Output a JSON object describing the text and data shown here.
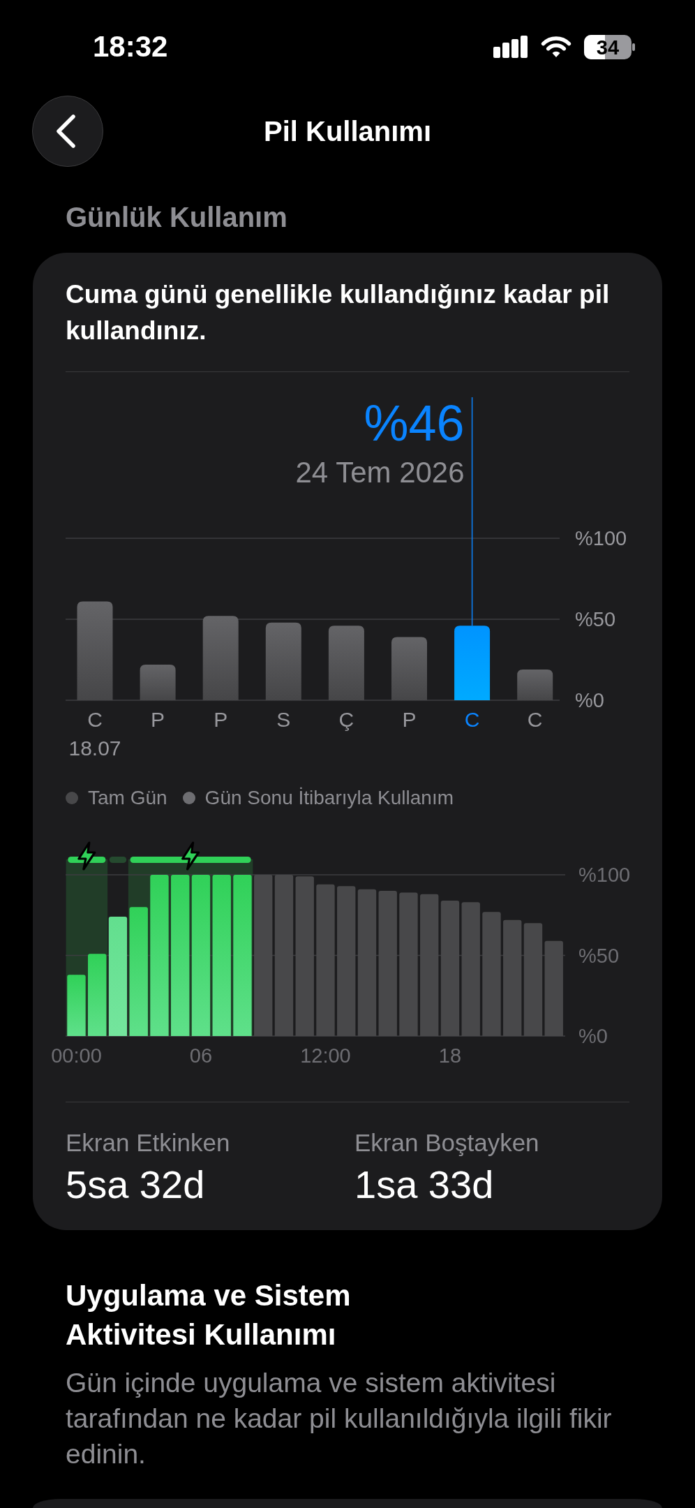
{
  "status_bar": {
    "time": "18:32",
    "battery_percent": "34"
  },
  "nav": {
    "title": "Pil Kullanımı"
  },
  "daily_usage": {
    "section_title": "Günlük Kullanım",
    "summary": "Cuma günü genellikle kullandığınız kadar pil kullandınız.",
    "daily_chart": {
      "selected_value": "%46",
      "selected_date": "24 Tem 2026",
      "first_date": "18.07",
      "days": [
        {
          "selected": false
        },
        {
          "selected": false
        },
        {
          "selected": false
        },
        {
          "selected": false
        },
        {
          "selected": false
        },
        {
          "selected": false
        },
        {
          "selected": true
        },
        {
          "selected": false
        }
      ],
      "chart_data": {
        "type": "bar",
        "categories": [
          "C",
          "P",
          "P",
          "S",
          "Ç",
          "P",
          "C",
          "C"
        ],
        "values": [
          61,
          22,
          52,
          48,
          46,
          39,
          46,
          19
        ],
        "ylim": [
          0,
          100
        ],
        "yticks": [
          {
            "value": 0,
            "label": "%0"
          },
          {
            "value": 50,
            "label": "%50"
          },
          {
            "value": 100,
            "label": "%100"
          }
        ]
      }
    },
    "legend": [
      {
        "label": "Tam Gün",
        "color": "#48484a"
      },
      {
        "label": "Gün Sonu İtibarıyla Kullanım",
        "color": "#6e6e72"
      }
    ],
    "hourly_chart": {
      "hours": [
        {
          "kind": "plugged"
        },
        {
          "kind": "plugged"
        },
        {
          "kind": "charging"
        },
        {
          "kind": "plugged"
        },
        {
          "kind": "plugged"
        },
        {
          "kind": "plugged"
        },
        {
          "kind": "plugged"
        },
        {
          "kind": "plugged"
        },
        {
          "kind": "plugged"
        },
        {
          "kind": "battery"
        },
        {
          "kind": "battery"
        },
        {
          "kind": "battery"
        },
        {
          "kind": "battery"
        },
        {
          "kind": "battery"
        },
        {
          "kind": "battery"
        },
        {
          "kind": "battery"
        },
        {
          "kind": "battery"
        },
        {
          "kind": "battery"
        },
        {
          "kind": "battery"
        },
        {
          "kind": "battery"
        },
        {
          "kind": "battery"
        },
        {
          "kind": "battery"
        },
        {
          "kind": "battery"
        },
        {
          "kind": "battery"
        }
      ],
      "chart_data": {
        "type": "bar",
        "x": [
          0,
          1,
          2,
          3,
          4,
          5,
          6,
          7,
          8,
          9,
          10,
          11,
          12,
          13,
          14,
          15,
          16,
          17,
          18,
          19,
          20,
          21,
          22,
          23
        ],
        "values": [
          38,
          51,
          74,
          80,
          100,
          100,
          100,
          100,
          100,
          100,
          100,
          99,
          94,
          93,
          91,
          90,
          89,
          88,
          84,
          83,
          77,
          72,
          70,
          59
        ],
        "xlim": [
          -0.5,
          23.5
        ],
        "ylim": [
          0,
          100
        ],
        "xticks": [
          {
            "value": 0,
            "label": "00:00"
          },
          {
            "value": 6,
            "label": "06"
          },
          {
            "value": 12,
            "label": "12:00"
          },
          {
            "value": 18,
            "label": "18"
          }
        ],
        "yticks": [
          {
            "value": 0,
            "label": "%0"
          },
          {
            "value": 50,
            "label": "%50"
          },
          {
            "value": 100,
            "label": "%100"
          }
        ],
        "bands": [
          {
            "axis": "x",
            "from": -0.5,
            "to": 1.5
          },
          {
            "axis": "x",
            "from": 2.5,
            "to": 8.5
          }
        ]
      }
    },
    "screen_time": [
      {
        "label": "Ekran Etkinken",
        "value": "5sa 32d"
      },
      {
        "label": "Ekran Boştayken",
        "value": "1sa 33d"
      }
    ]
  },
  "activity_section": {
    "title": "Uygulama ve Sistem Aktivitesi Kullanımı",
    "description": "Gün içinde uygulama ve sistem aktivitesi tarafından ne kadar pil kullanıldığıyla ilgili fikir edinin."
  }
}
